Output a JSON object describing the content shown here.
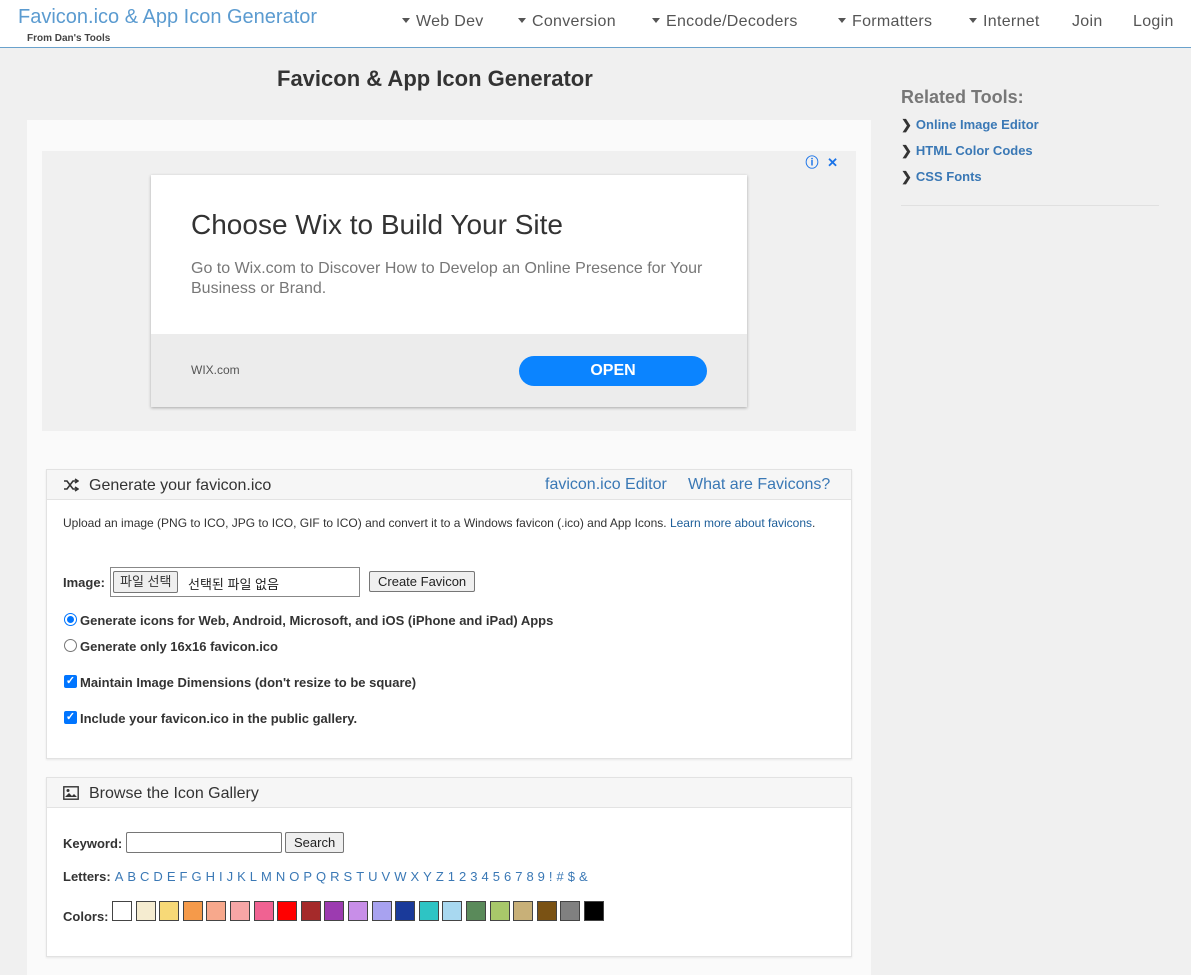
{
  "header": {
    "brand_title": "Favicon.ico & App Icon Generator",
    "brand_sub": "From Dan's Tools",
    "nav": [
      {
        "label": "Web Dev",
        "dropdown": true
      },
      {
        "label": "Conversion",
        "dropdown": true
      },
      {
        "label": "Encode/Decoders",
        "dropdown": true
      },
      {
        "label": "Formatters",
        "dropdown": true
      },
      {
        "label": "Internet",
        "dropdown": true
      },
      {
        "label": "Join",
        "dropdown": false
      },
      {
        "label": "Login",
        "dropdown": false
      }
    ]
  },
  "main": {
    "title": "Favicon & App Icon Generator"
  },
  "ad": {
    "info_icon": "ⓘ",
    "close_icon": "✕",
    "headline": "Choose Wix to Build Your Site",
    "description": "Go to Wix.com to Discover How to Develop an Online Presence for Your Business or Brand.",
    "domain": "WIX.com",
    "cta": "OPEN"
  },
  "generate": {
    "title": "Generate your favicon.ico",
    "link_editor": "favicon.ico Editor",
    "link_what": "What are Favicons?",
    "intro": "Upload an image (PNG to ICO, JPG to ICO, GIF to ICO) and convert it to a Windows favicon (.ico) and App Icons.",
    "learn_more": "Learn more about favicons",
    "image_label": "Image:",
    "file_button": "파일 선택",
    "file_status": "선택된 파일 없음",
    "create_button": "Create Favicon",
    "radio_all": "Generate icons for Web, Android, Microsoft, and iOS (iPhone and iPad) Apps",
    "radio_16": "Generate only 16x16 favicon.ico",
    "check_dims": "Maintain Image Dimensions (don't resize to be square)",
    "check_gallery": "Include your favicon.ico in the public gallery."
  },
  "gallery": {
    "title": "Browse the Icon Gallery",
    "keyword_label": "Keyword:",
    "keyword_value": "",
    "search_button": "Search",
    "letters_label": "Letters:",
    "letters": [
      "A",
      "B",
      "C",
      "D",
      "E",
      "F",
      "G",
      "H",
      "I",
      "J",
      "K",
      "L",
      "M",
      "N",
      "O",
      "P",
      "Q",
      "R",
      "S",
      "T",
      "U",
      "V",
      "W",
      "X",
      "Y",
      "Z",
      "1",
      "2",
      "3",
      "4",
      "5",
      "6",
      "7",
      "8",
      "9",
      "!",
      "#",
      "$",
      "&"
    ],
    "colors_label": "Colors:",
    "colors": [
      "#ffffff",
      "#f5ecd0",
      "#f7d977",
      "#f59a4a",
      "#f7a88c",
      "#f7a6a6",
      "#f06292",
      "#ff0000",
      "#a52a2a",
      "#9c3bb0",
      "#c88ee8",
      "#a8a2f0",
      "#1a3a9a",
      "#2ec4c4",
      "#a8d8f0",
      "#5a8a5a",
      "#a8c86a",
      "#c8b078",
      "#7a5214",
      "#808080",
      "#000000"
    ]
  },
  "sidebar": {
    "title": "Related Tools:",
    "items": [
      {
        "label": "Online Image Editor"
      },
      {
        "label": "HTML Color Codes"
      },
      {
        "label": "CSS Fonts"
      }
    ]
  }
}
